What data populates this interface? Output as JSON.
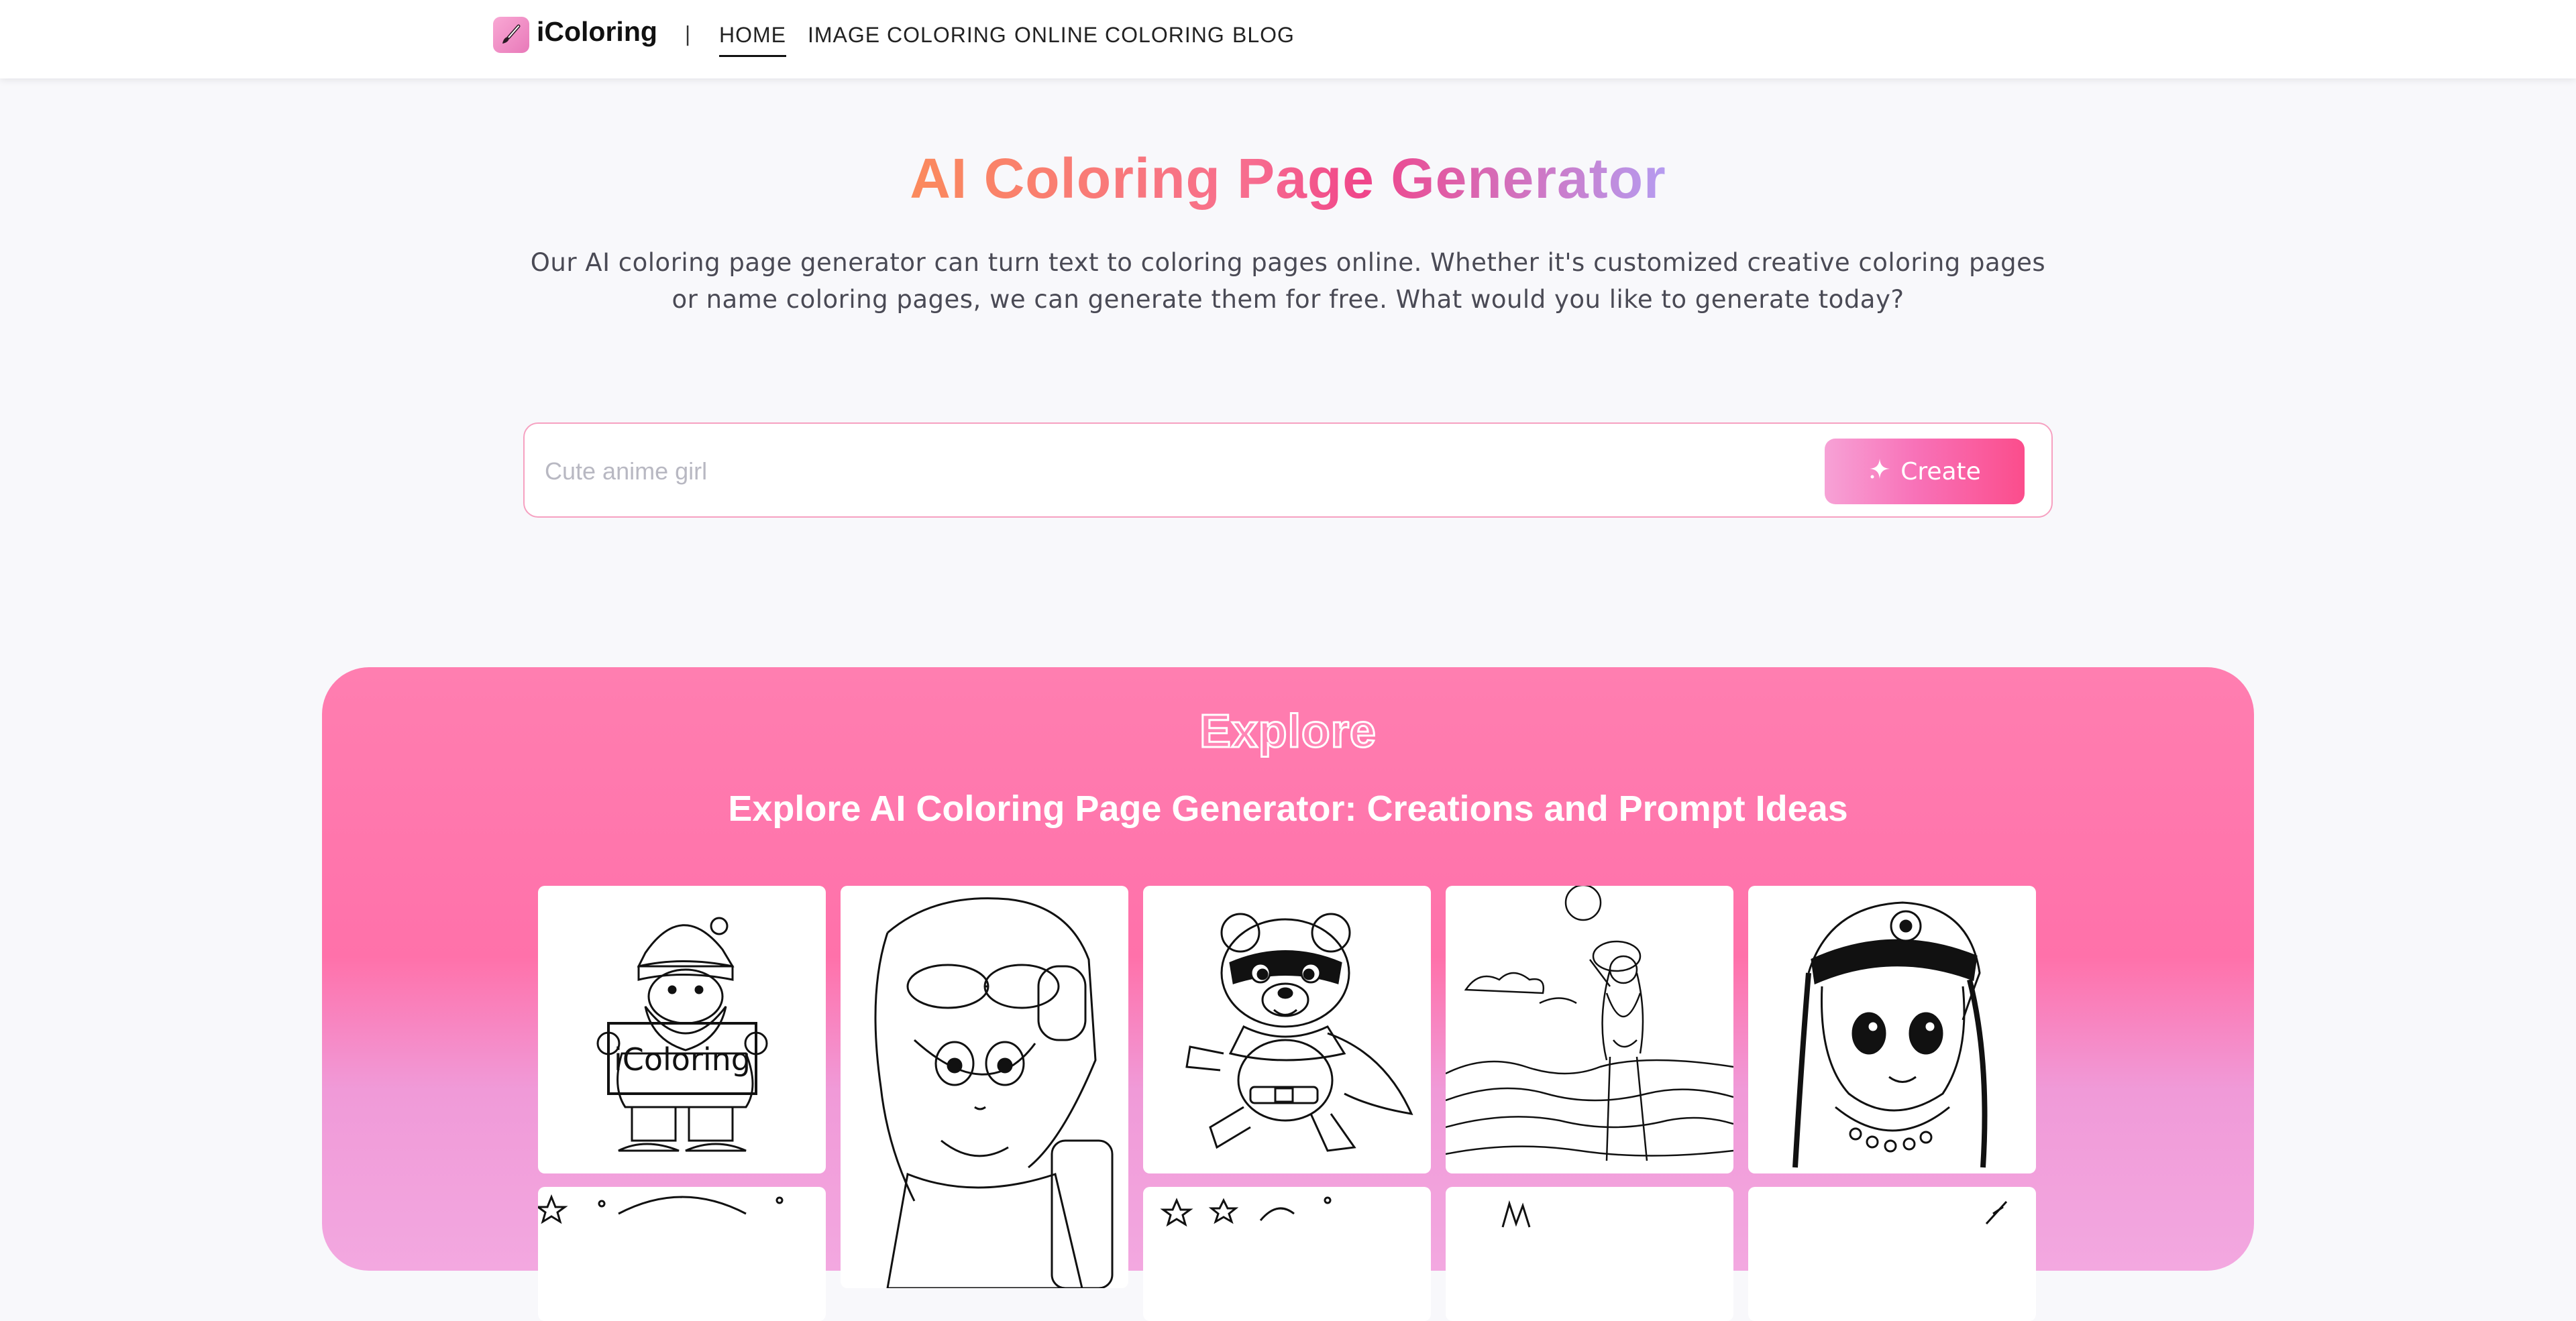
{
  "header": {
    "brand": "iColoring",
    "separator": "|",
    "nav": [
      {
        "label": "HOME",
        "active": true
      },
      {
        "label": "IMAGE COLORING",
        "active": false
      },
      {
        "label": "ONLINE COLORING",
        "active": false
      },
      {
        "label": "BLOG",
        "active": false
      }
    ]
  },
  "hero": {
    "title": "AI Coloring Page Generator",
    "description": "Our AI coloring page generator can turn text to coloring pages online. Whether it's customized creative coloring pages or name coloring pages, we can generate them for free. What would you like to generate today?",
    "search": {
      "placeholder": "Cute anime girl",
      "value": "",
      "button_label": "Create",
      "button_icon": "sparkle-icon"
    }
  },
  "explore": {
    "heading": "Explore",
    "subheading": "Explore AI Coloring Page Generator: Creations and Prompt Ideas",
    "cards": [
      {
        "subject": "santa-with-sign",
        "sign_text": "iColoring"
      },
      {
        "subject": "anime-girl-headphones"
      },
      {
        "subject": "superhero-bear"
      },
      {
        "subject": "beach-girl"
      },
      {
        "subject": "girl-with-headband"
      }
    ]
  },
  "colors": {
    "accent_pink": "#fb4d8c",
    "explore_bg": "#ff7eb0",
    "title_gradient": [
      "#fb8a5c",
      "#f0458a",
      "#b59cf0"
    ]
  }
}
